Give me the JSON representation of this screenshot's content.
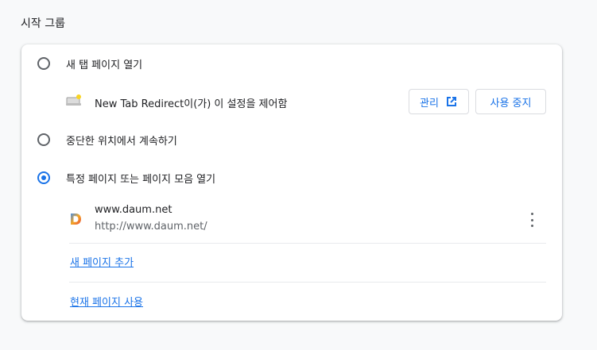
{
  "section": {
    "title": "시작 그룹"
  },
  "options": [
    {
      "label": "새 탭 페이지 열기",
      "checked": false
    },
    {
      "label": "중단한 위치에서 계속하기",
      "checked": false
    },
    {
      "label": "특정 페이지 또는 페이지 모음 열기",
      "checked": true
    }
  ],
  "extension_notice": {
    "text": "New Tab Redirect이(가) 이 설정을 제어함",
    "manage_label": "관리",
    "disable_label": "사용 중지",
    "icon": "extension-icon"
  },
  "pages": [
    {
      "name": "www.daum.net",
      "url": "http://www.daum.net/",
      "favicon": "daum-favicon"
    }
  ],
  "links": {
    "add_page": "새 페이지 추가",
    "use_current": "현재 페이지 사용"
  },
  "colors": {
    "accent": "#1a73e8",
    "text": "#202124",
    "secondary_text": "#5f6368",
    "divider": "#e8eaed"
  }
}
